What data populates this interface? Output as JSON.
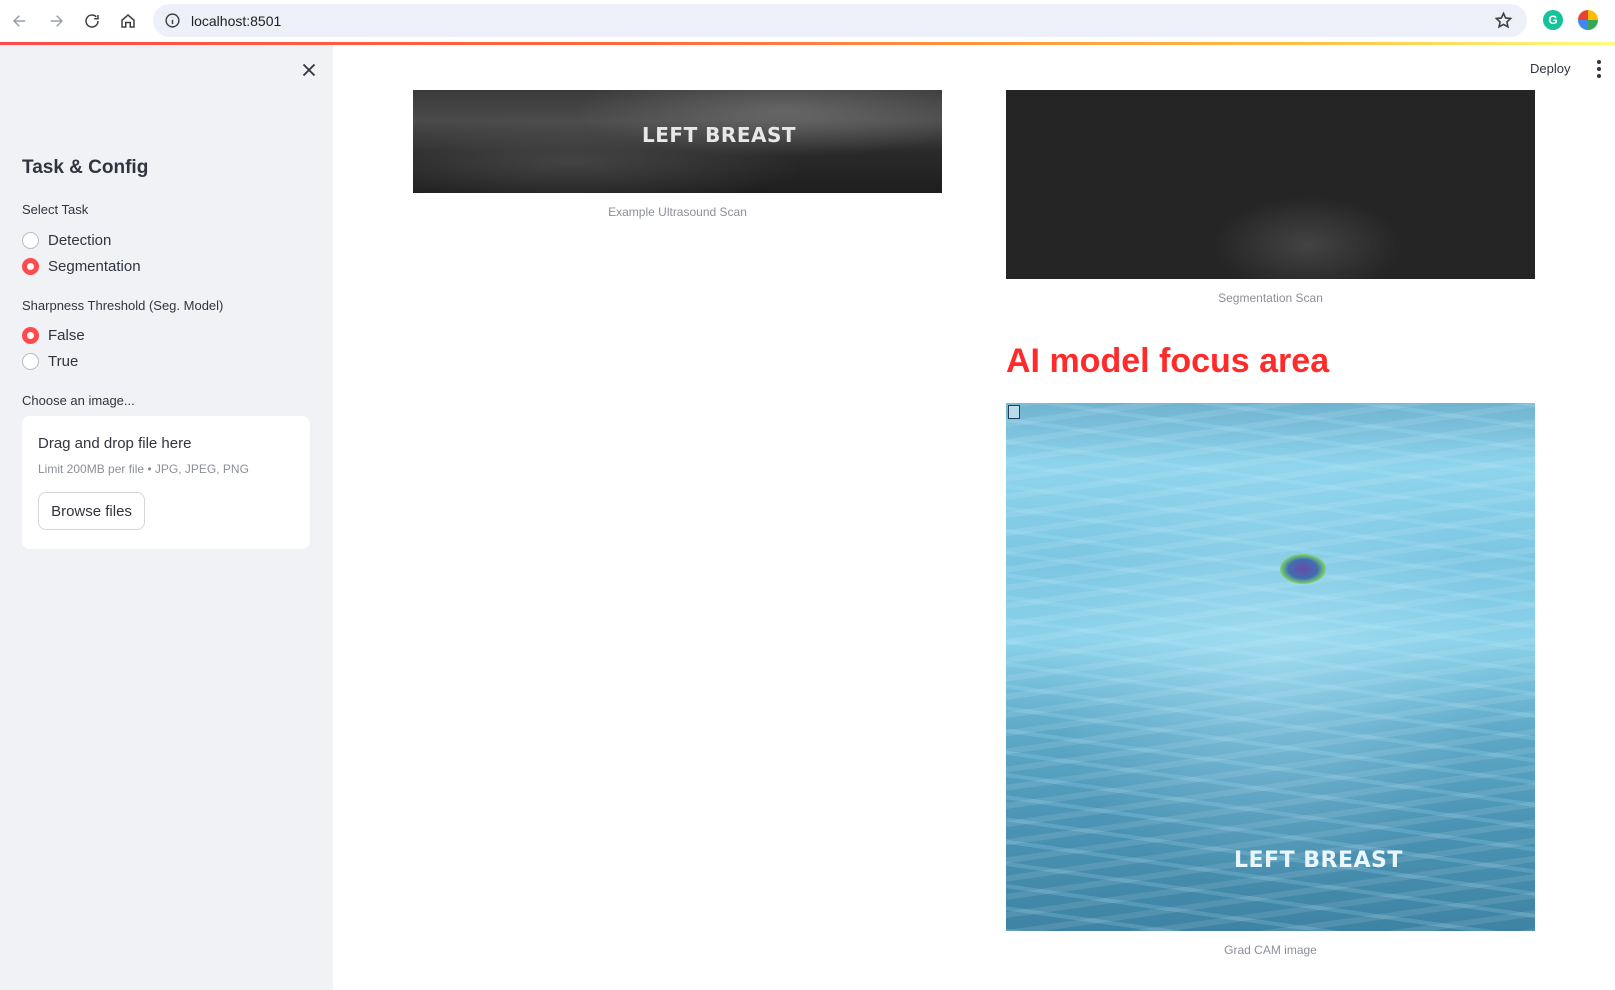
{
  "browser": {
    "url": "localhost:8501"
  },
  "sidebar": {
    "heading": "Task & Config",
    "task_label": "Select Task",
    "task_options": [
      {
        "label": "Detection",
        "checked": false
      },
      {
        "label": "Segmentation",
        "checked": true
      }
    ],
    "sharpness_label": "Sharpness Threshold (Seg. Model)",
    "sharpness_options": [
      {
        "label": "False",
        "checked": true
      },
      {
        "label": "True",
        "checked": false
      }
    ],
    "uploader_label": "Choose an image...",
    "uploader": {
      "title": "Drag and drop file here",
      "subtitle": "Limit 200MB per file • JPG, JPEG, PNG",
      "button": "Browse files"
    }
  },
  "header": {
    "deploy": "Deploy"
  },
  "main": {
    "example_image_text": "LEFT BREAST",
    "example_caption": "Example Ultrasound Scan",
    "segmentation_caption": "Segmentation Scan",
    "focus_heading": "AI model focus area",
    "gradcam_image_text": "LEFT BREAST",
    "gradcam_caption": "Grad CAM image"
  },
  "colors": {
    "accent": "#ff4b4b",
    "heading_red": "#ff2b2b",
    "sidebar_bg": "#f0f2f6"
  }
}
